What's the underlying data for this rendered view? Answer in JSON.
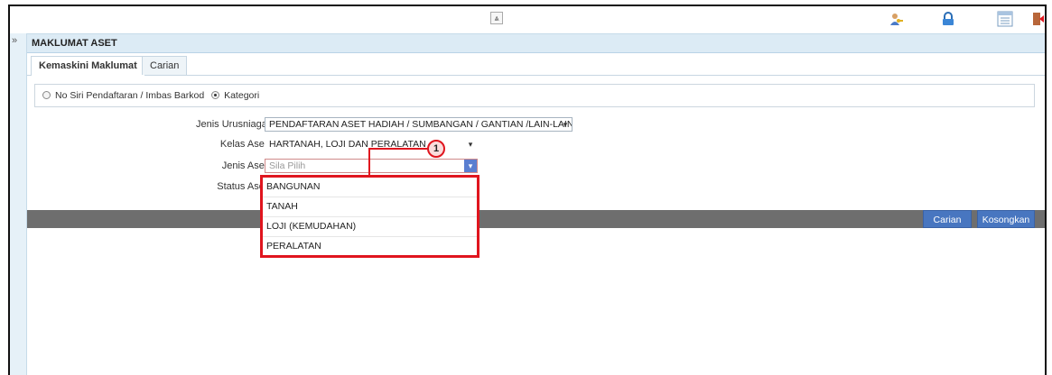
{
  "toolbar": {
    "collapse_glyph": "⩓",
    "icons": [
      "user-key-icon",
      "lock-icon",
      "calendar-list-icon",
      "exit-icon"
    ]
  },
  "sidebar": {
    "expand_glyph": "»"
  },
  "header": {
    "title": "MAKLUMAT ASET"
  },
  "tabs": [
    {
      "label": "Kemaskini Maklumat",
      "active": true
    },
    {
      "label": "Carian",
      "active": false
    }
  ],
  "search_mode": {
    "option1": "No Siri Pendaftaran / Imbas Barkod",
    "option2": "Kategori",
    "selected": "Kategori"
  },
  "form": {
    "jenis_urusniaga": {
      "label": "Jenis Urusniaga :",
      "value": "PENDAFTARAN ASET HADIAH / SUMBANGAN / GANTIAN /LAIN-LAIN"
    },
    "kelas_aset": {
      "label": "Kelas Aset :",
      "value": "HARTANAH, LOJI DAN PERALATAN"
    },
    "jenis_aset": {
      "label": "Jenis Aset :",
      "placeholder": "Sila Pilih"
    },
    "status_aset": {
      "label": "Status Aset :"
    }
  },
  "dropdown": {
    "options": [
      "BANGUNAN",
      "TANAH",
      "LOJI (KEMUDAHAN)",
      "PERALATAN"
    ]
  },
  "actions": {
    "carian": "Carian",
    "kosongkan": "Kosongkan"
  },
  "annotation": {
    "number": "1"
  },
  "colors": {
    "accent_red": "#e0151e",
    "button_blue": "#4876c0",
    "header_bg": "#dcebf5"
  }
}
